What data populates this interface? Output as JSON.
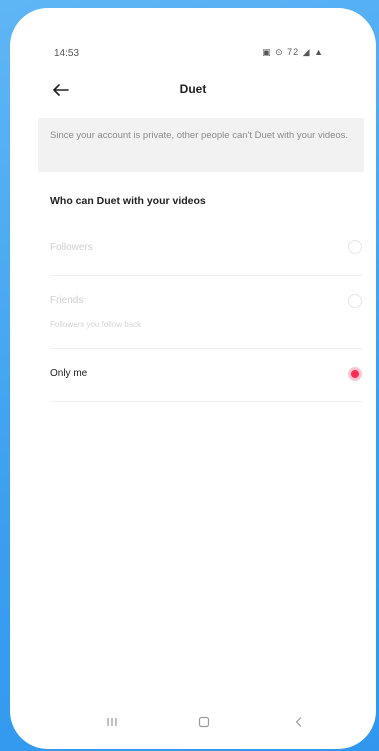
{
  "status_bar": {
    "time": "14:53",
    "icons": "▣ ⊙ 72 ◢ ▲"
  },
  "header": {
    "title": "Duet"
  },
  "notice": {
    "text": "Since your account is private, other people can't Duet with your videos."
  },
  "section": {
    "title": "Who can Duet with your videos"
  },
  "options": [
    {
      "label": "Followers",
      "selected": false,
      "enabled": false
    },
    {
      "label": "Friends",
      "sublabel": "Followers you follow back",
      "selected": false,
      "enabled": false
    },
    {
      "label": "Only me",
      "selected": true,
      "enabled": true
    }
  ],
  "colors": {
    "accent": "#fe2c55",
    "background": "#ffffff",
    "frame": "#3a9ff0"
  }
}
